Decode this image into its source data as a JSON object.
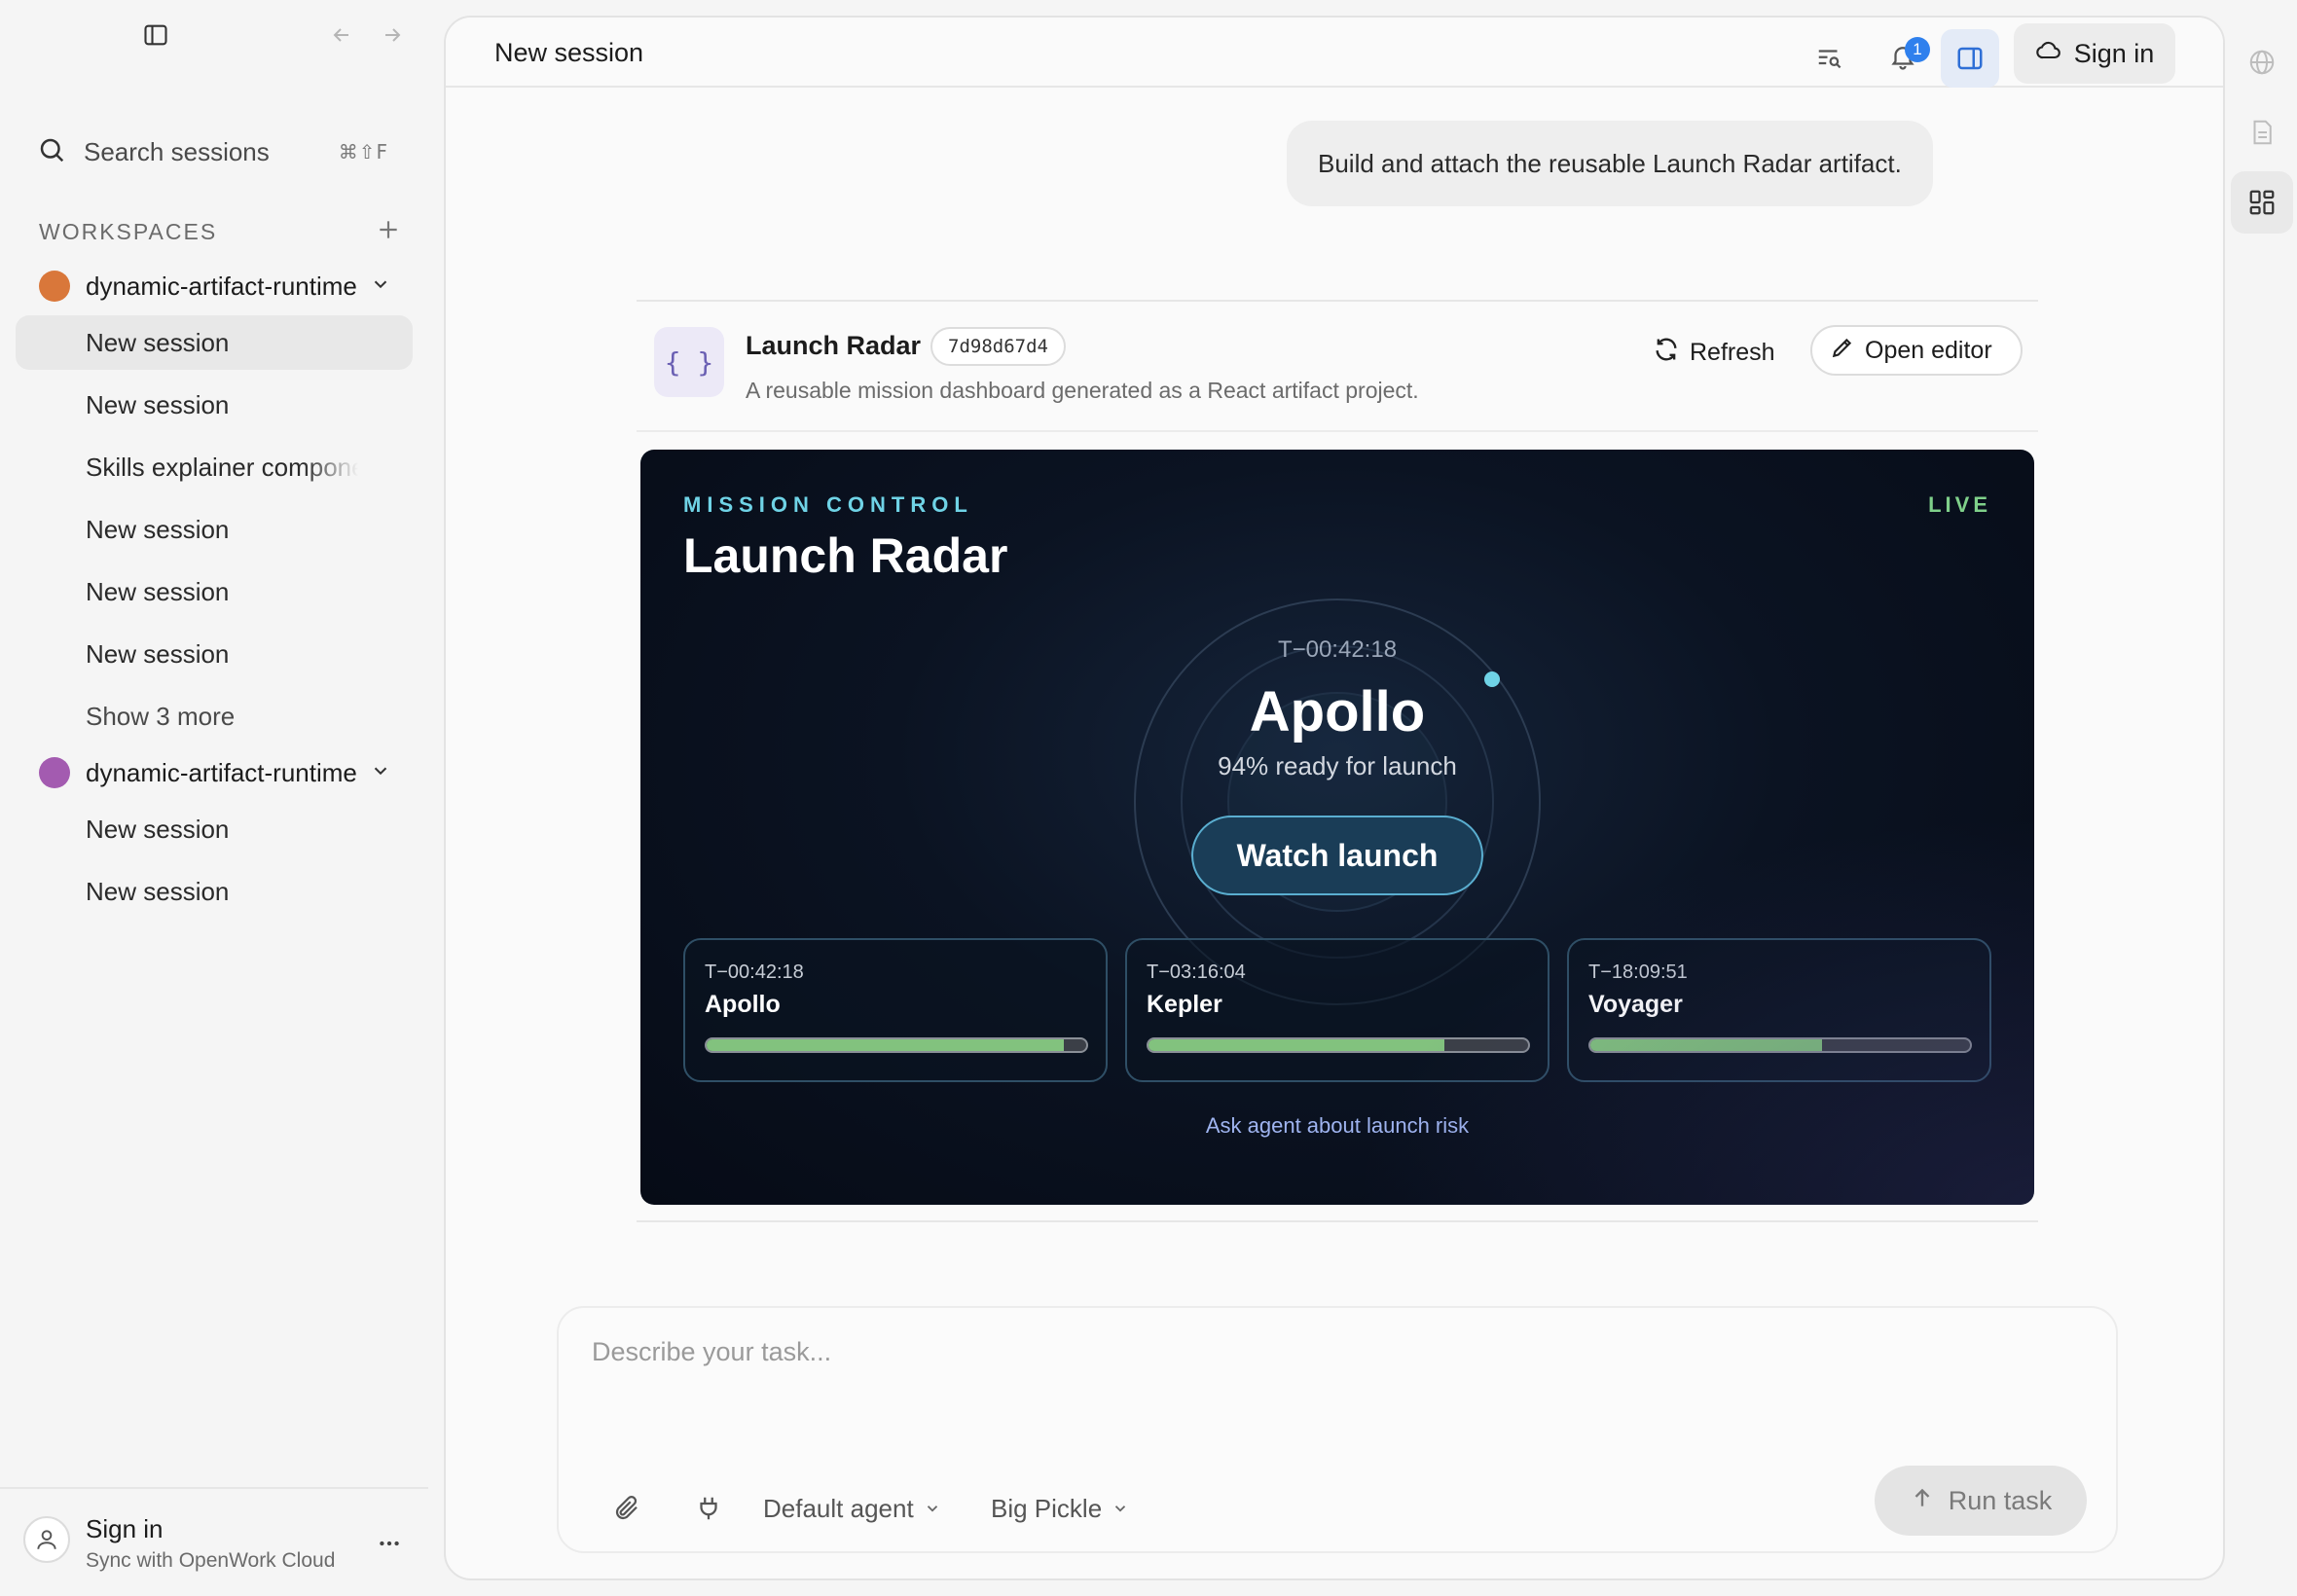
{
  "sidebar": {
    "search_label": "Search sessions",
    "search_shortcut": "⌘⇧F",
    "workspaces_label": "WORKSPACES",
    "workspaces": [
      {
        "name": "dynamic-artifact-runtime",
        "color": "#d9773a",
        "sessions": [
          "New session",
          "New session",
          "Skills explainer component",
          "New session",
          "New session",
          "New session"
        ],
        "show_more": "Show 3 more"
      },
      {
        "name": "dynamic-artifact-runtime",
        "color": "#a35bb0",
        "sessions": [
          "New session",
          "New session"
        ]
      }
    ],
    "footer": {
      "title": "Sign in",
      "subtitle": "Sync with OpenWork Cloud"
    }
  },
  "topbar": {
    "title": "New session",
    "notification_count": "1",
    "sign_in": "Sign in"
  },
  "chat": {
    "user_message": "Build and attach the reusable Launch Radar artifact."
  },
  "artifact": {
    "icon_text": "{ }",
    "name": "Launch Radar",
    "hash": "7d98d67d4",
    "description": "A reusable mission dashboard generated as a React artifact project.",
    "refresh_label": "Refresh",
    "open_editor_label": "Open editor",
    "view": {
      "kicker": "MISSION CONTROL",
      "title": "Launch Radar",
      "live": "LIVE",
      "focus": {
        "time": "T−00:42:18",
        "name": "Apollo",
        "ready": "94% ready for launch"
      },
      "watch_button": "Watch launch",
      "missions": [
        {
          "time": "T−00:42:18",
          "name": "Apollo",
          "progress": 0.94
        },
        {
          "time": "T−03:16:04",
          "name": "Kepler",
          "progress": 0.78
        },
        {
          "time": "T−18:09:51",
          "name": "Voyager",
          "progress": 0.61
        }
      ],
      "ask_link": "Ask agent about launch risk"
    }
  },
  "composer": {
    "placeholder": "Describe your task...",
    "agent": "Default agent",
    "model": "Big Pickle",
    "run_label": "Run task"
  }
}
